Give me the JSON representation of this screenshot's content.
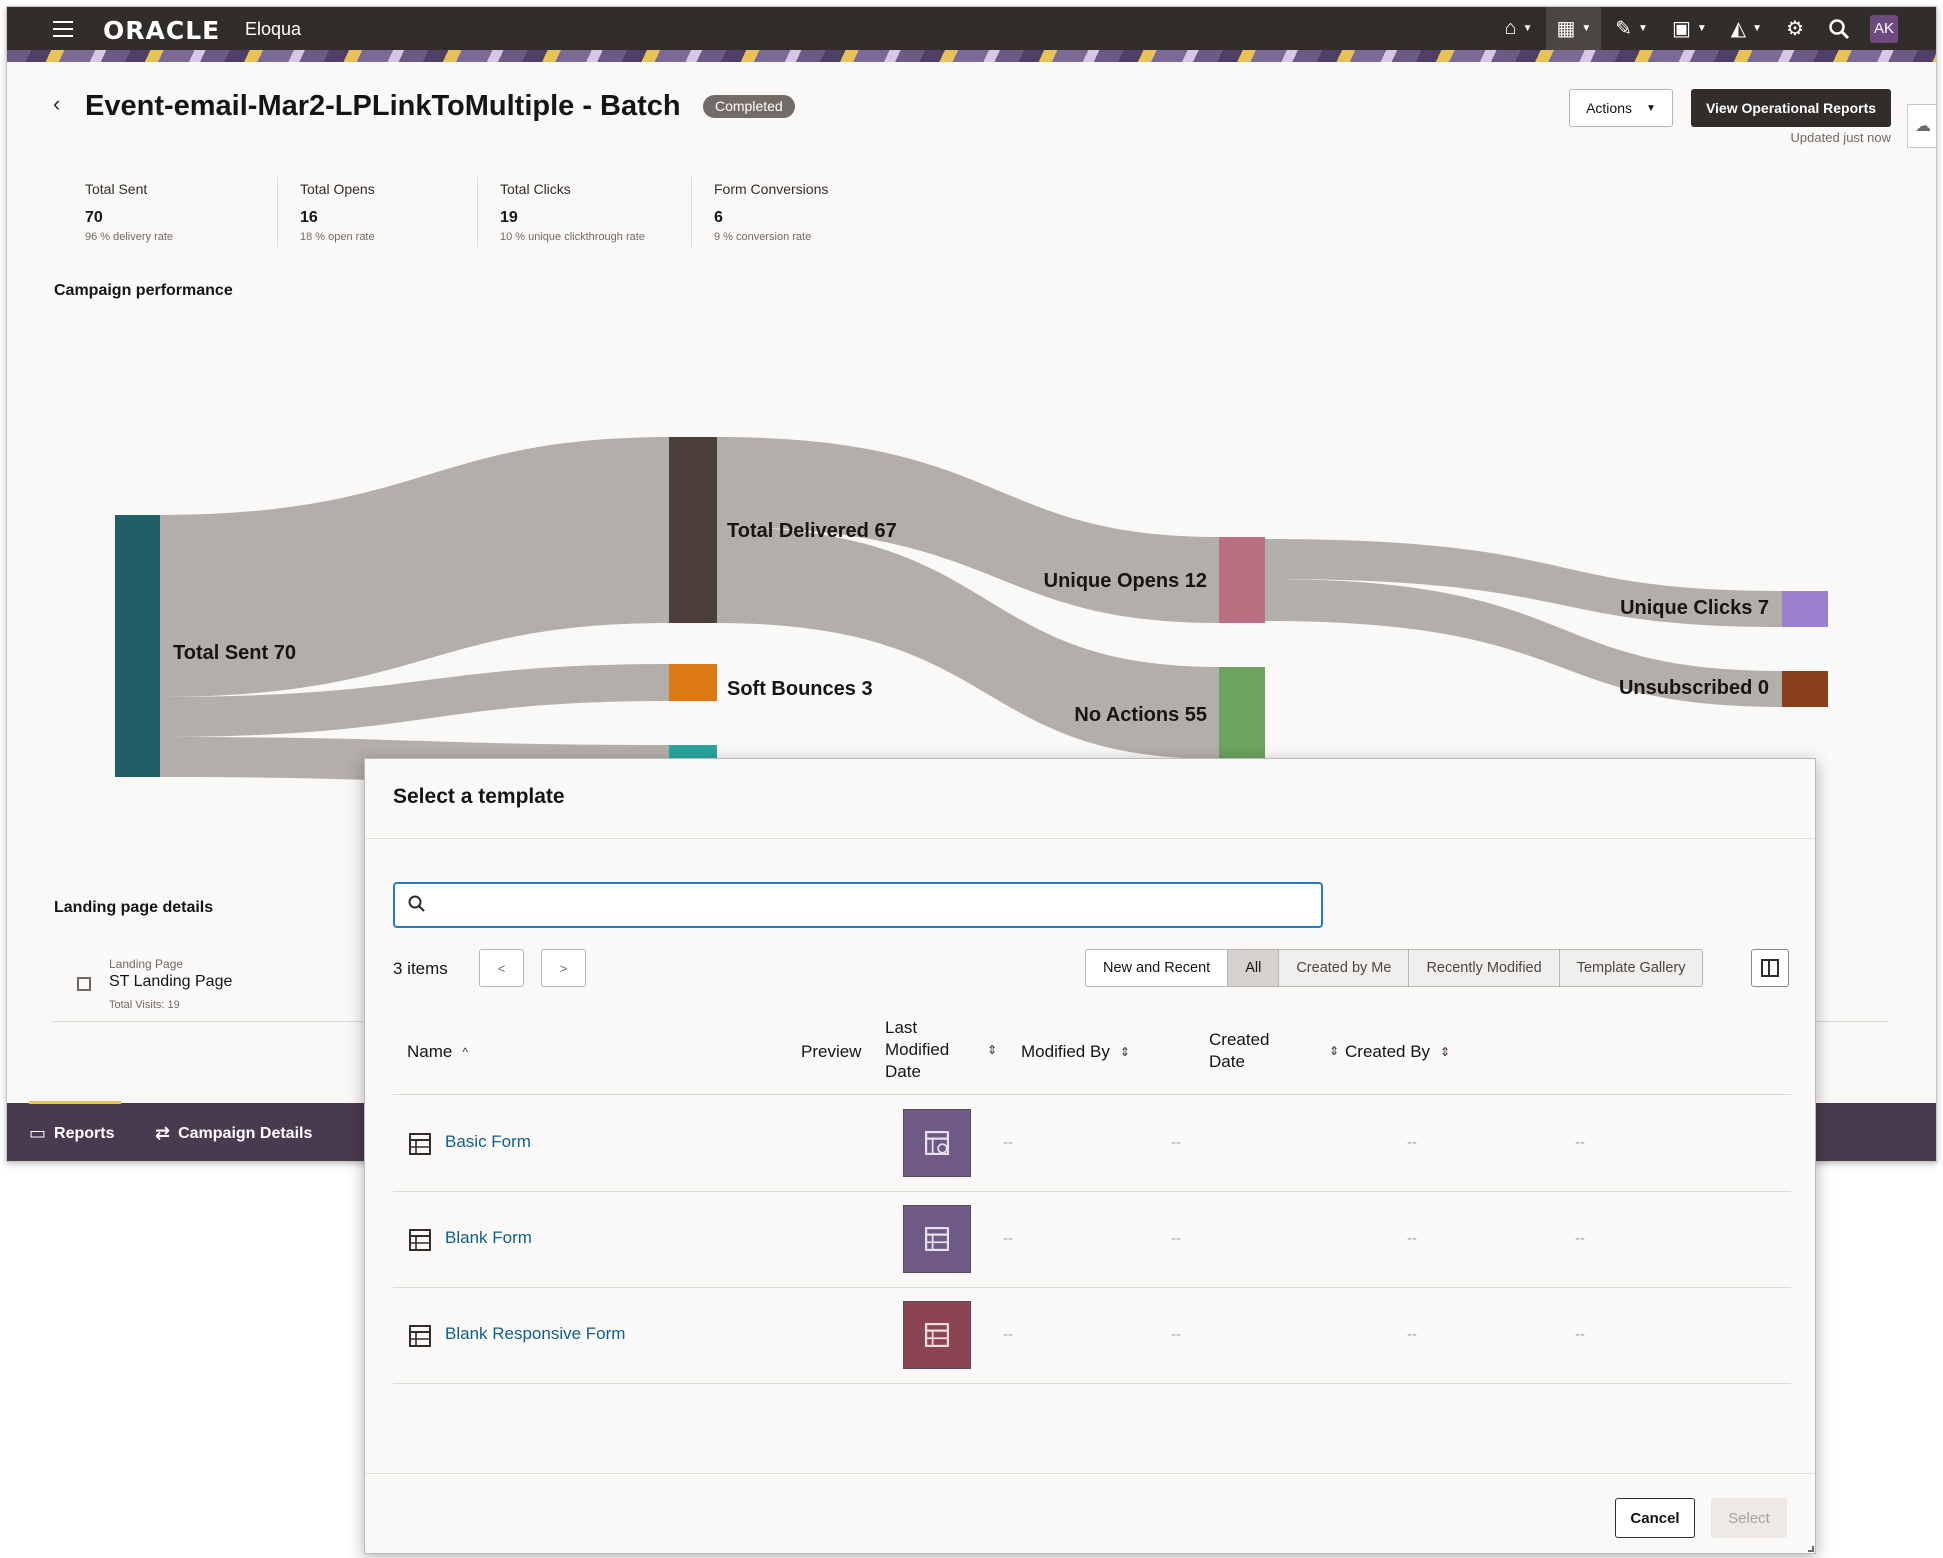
{
  "topbar": {
    "brand": "ORACLE",
    "product": "Eloqua",
    "icons": [
      "home-icon",
      "dashboard-icon",
      "edit-icon",
      "assets-icon",
      "analytics-icon",
      "gear-icon",
      "search-icon"
    ],
    "avatar_initials": "AK"
  },
  "header": {
    "title": "Event-email-Mar2-LPLinkToMultiple - Batch",
    "status": "Completed",
    "actions_label": "Actions",
    "reports_label": "View Operational Reports",
    "updated": "Updated just now"
  },
  "metrics": [
    {
      "label": "Total Sent",
      "value": "70",
      "sub": "96 % delivery rate"
    },
    {
      "label": "Total Opens",
      "value": "16",
      "sub": "18 % open rate"
    },
    {
      "label": "Total Clicks",
      "value": "19",
      "sub": "10 % unique clickthrough rate"
    },
    {
      "label": "Form Conversions",
      "value": "6",
      "sub": "9 % conversion rate"
    }
  ],
  "performance": {
    "title": "Campaign performance",
    "nodes": {
      "sent": "Total Sent 70",
      "delivered": "Total Delivered 67",
      "soft_bounces": "Soft Bounces 3",
      "unique_opens": "Unique Opens 12",
      "no_actions": "No Actions 55",
      "unique_clicks": "Unique Clicks 7",
      "unsubscribed": "Unsubscribed 0"
    },
    "colors": {
      "sent": "#215f66",
      "delivered": "#4b3f38",
      "soft_bounces": "#dd7a15",
      "hidden": "#2aa69e",
      "unique_opens": "#b96f80",
      "no_actions": "#6ba35f",
      "unique_clicks": "#9b80d0",
      "unsubscribed": "#8a3f1c",
      "link": "#b2aeaa"
    }
  },
  "landing": {
    "title": "Landing page details",
    "kicker": "Landing Page",
    "name": "ST Landing Page",
    "visits": "Total Visits: 19"
  },
  "footer_tabs": {
    "reports": "Reports",
    "details": "Campaign Details"
  },
  "modal": {
    "title": "Select a template",
    "search_placeholder": "",
    "count": "3 items",
    "prev": "<",
    "next": ">",
    "filters": [
      "New and Recent",
      "All",
      "Created by Me",
      "Recently Modified",
      "Template Gallery"
    ],
    "selected_filter": "All",
    "columns": {
      "name": "Name",
      "preview": "Preview",
      "last_modified_line1": "Last",
      "last_modified_line2": "Modified",
      "last_modified_line3": "Date",
      "modified_by": "Modified By",
      "created_date_line1": "Created",
      "created_date_line2": "Date",
      "created_by": "Created By"
    },
    "rows": [
      {
        "name": "Basic Form",
        "thumb_color": "#6f5a86",
        "last_modified": "--",
        "modified_by": "--",
        "created_date": "--",
        "created_by": "--"
      },
      {
        "name": "Blank Form",
        "thumb_color": "#6f5a86",
        "last_modified": "--",
        "modified_by": "--",
        "created_date": "--",
        "created_by": "--"
      },
      {
        "name": "Blank Responsive Form",
        "thumb_color": "#8b4552",
        "last_modified": "--",
        "modified_by": "--",
        "created_date": "--",
        "created_by": "--"
      }
    ],
    "cancel_label": "Cancel",
    "select_label": "Select"
  }
}
